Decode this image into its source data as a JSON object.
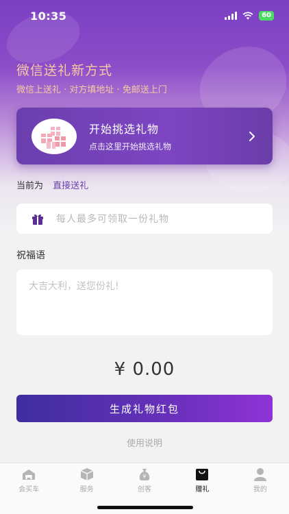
{
  "status": {
    "time": "10:35",
    "battery": "60"
  },
  "hero": {
    "title": "微信送礼新方式",
    "subtitle": "微信上送礼 · 对方填地址 · 免邮送上门"
  },
  "pick_card": {
    "title": "开始挑选礼物",
    "subtitle": "点击这里开始挑选礼物",
    "icon": "gift-boxes-image"
  },
  "mode": {
    "label": "当前为",
    "value": "直接送礼"
  },
  "rule": {
    "text": "每人最多可领取一份礼物",
    "icon": "gift-icon"
  },
  "blessing": {
    "label": "祝福语",
    "placeholder": "大吉大利，送您份礼!"
  },
  "amount": "¥ 0.00",
  "generate_button": "生成礼物红包",
  "instructions_link": "使用说明",
  "bottom_nav": [
    {
      "label": "会买车",
      "icon": "car-house-icon",
      "active": false
    },
    {
      "label": "服务",
      "icon": "box-icon",
      "active": false
    },
    {
      "label": "创客",
      "icon": "money-bag-icon",
      "active": false
    },
    {
      "label": "赠礼",
      "icon": "bag-icon",
      "active": true
    },
    {
      "label": "我的",
      "icon": "person-icon",
      "active": false
    }
  ],
  "colors": {
    "brand_purple": "#6a3da8",
    "hero_text": "#f8c9a4",
    "button_gradient_start": "#3f2ea0",
    "button_gradient_end": "#8f33d6"
  }
}
